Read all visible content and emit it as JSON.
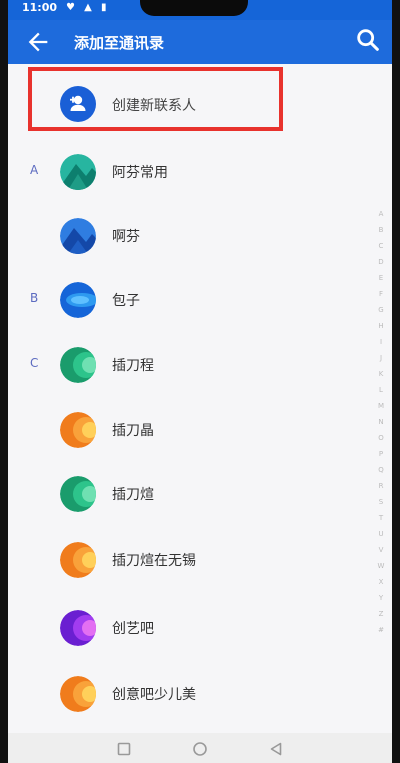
{
  "status_bar": {
    "time": "11:00",
    "icons": [
      "notification-icon",
      "signal-icon",
      "battery-icon"
    ]
  },
  "app_bar": {
    "title": "添加至通讯录",
    "back_icon": "back-arrow-icon",
    "search_icon": "search-icon"
  },
  "create_contact": {
    "label": "创建新联系人",
    "icon": "add-person-icon"
  },
  "contacts": [
    {
      "letter": "A",
      "name": "阿芬常用"
    },
    {
      "letter": "",
      "name": "啊芬"
    },
    {
      "letter": "B",
      "name": "包子"
    },
    {
      "letter": "C",
      "name": "插刀程"
    },
    {
      "letter": "",
      "name": "插刀晶"
    },
    {
      "letter": "",
      "name": "插刀煊"
    },
    {
      "letter": "",
      "name": "插刀煊在无锡"
    },
    {
      "letter": "",
      "name": "创艺吧"
    },
    {
      "letter": "",
      "name": "创意吧少儿美"
    }
  ],
  "alphabet_index": [
    "A",
    "B",
    "C",
    "D",
    "E",
    "F",
    "G",
    "H",
    "I",
    "J",
    "K",
    "L",
    "M",
    "N",
    "O",
    "P",
    "Q",
    "R",
    "S",
    "T",
    "U",
    "V",
    "W",
    "X",
    "Y",
    "Z",
    "#"
  ],
  "colors": {
    "primary": "#1e6bdc",
    "highlight": "#e8322d"
  }
}
